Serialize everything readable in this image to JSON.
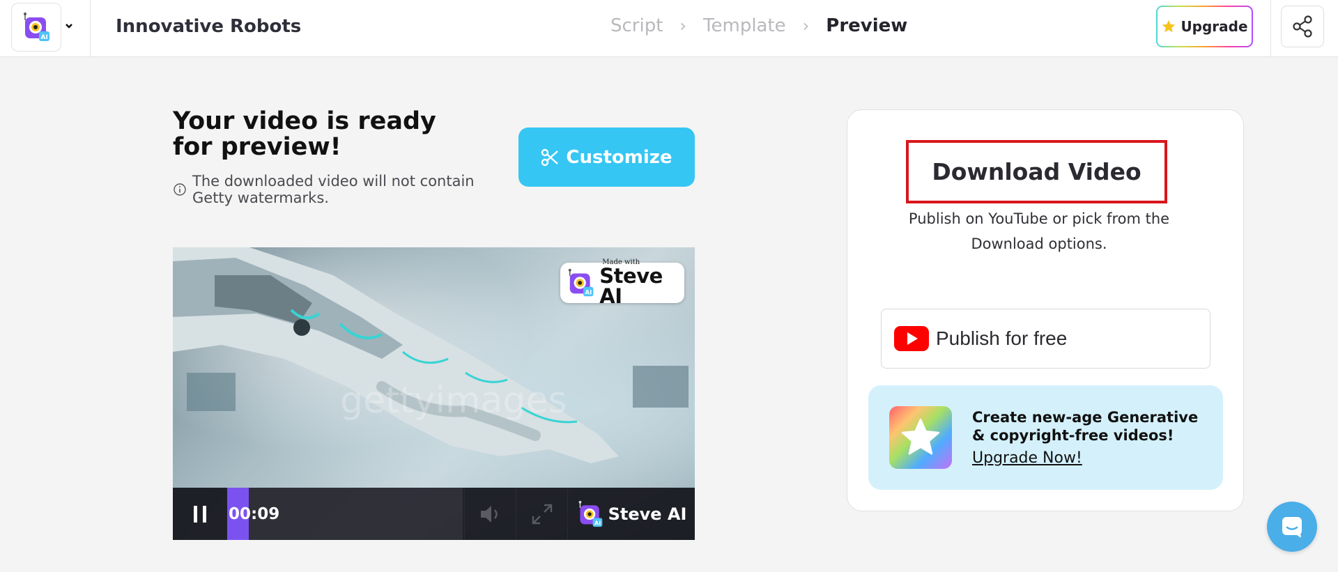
{
  "header": {
    "project_title": "Innovative Robots",
    "steps": [
      "Script",
      "Template",
      "Preview"
    ],
    "active_step": "Preview",
    "upgrade_label": "Upgrade",
    "accent": "#35c6f4"
  },
  "main": {
    "ready_title": "Your video is ready for preview!",
    "note": "The downloaded video will not contain Getty watermarks.",
    "customize_label": "Customize"
  },
  "video": {
    "watermark": "gettyimages",
    "badge_small": "Made with",
    "badge_big": "Steve AI",
    "time": "00:09",
    "progress": 0.05,
    "brand": "Steve AI"
  },
  "panel": {
    "download_label": "Download Video",
    "publish_note": "Publish on YouTube or pick from the Download options.",
    "publish_label": "Publish for free",
    "promo_title": "Create new-age Generative & copyright-free videos!",
    "promo_link": "Upgrade Now!",
    "highlight_color": "#d8161b"
  },
  "icons": [
    "app-logo-icon",
    "chevron-down-icon",
    "star-icon",
    "share-icon",
    "info-icon",
    "scissors-icon",
    "pause-icon",
    "volume-icon",
    "fullscreen-icon",
    "youtube-icon",
    "chat-icon"
  ]
}
